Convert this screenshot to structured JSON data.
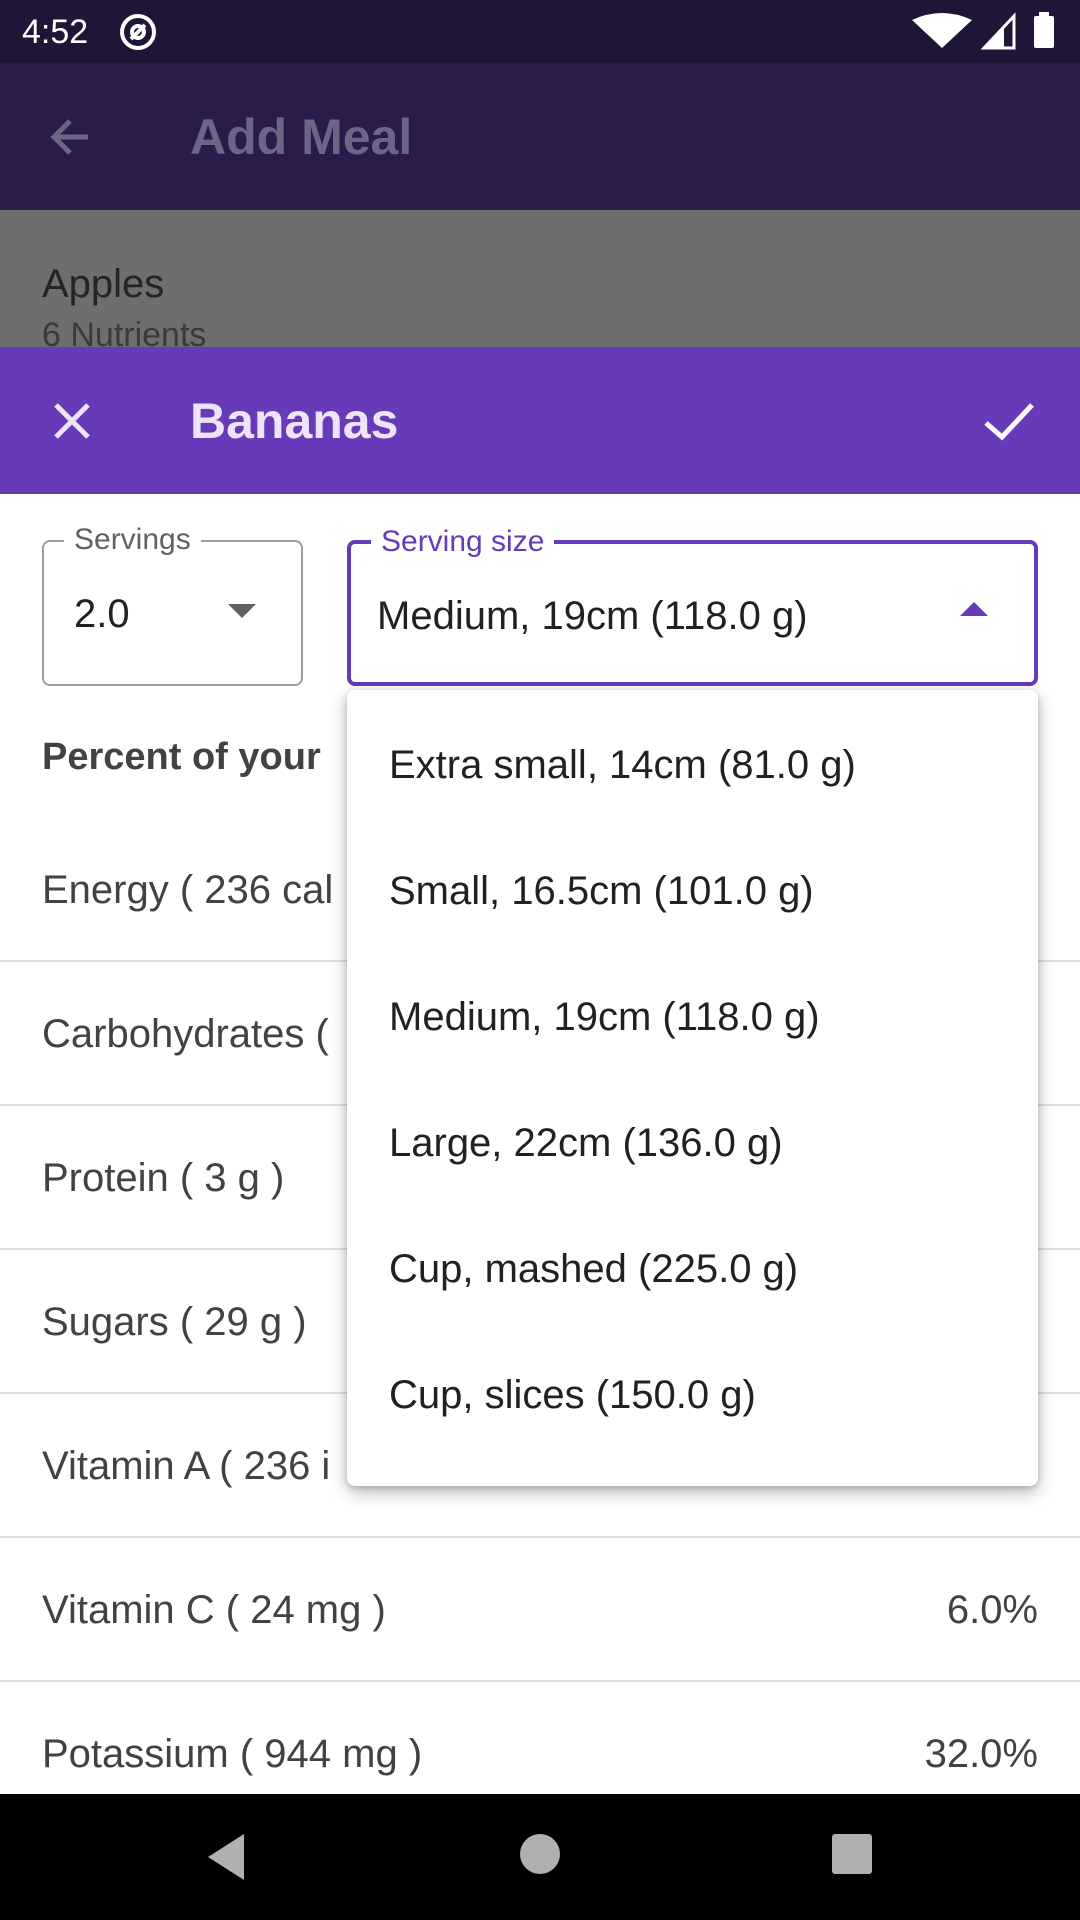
{
  "status_bar": {
    "time": "4:52",
    "left_icon": "at-sign-icon",
    "right_icons": [
      "wifi-icon",
      "signal-icon",
      "battery-icon"
    ]
  },
  "app_bar": {
    "title": "Add Meal",
    "back_icon": "arrow-back-icon"
  },
  "background_list": {
    "item_title": "Apples",
    "item_subtitle": "6 Nutrients"
  },
  "dialog": {
    "title": "Bananas",
    "close_icon": "close-icon",
    "confirm_icon": "check-icon",
    "accent_color": "#673ab7",
    "servings": {
      "label": "Servings",
      "value": "2.0"
    },
    "serving_size": {
      "label": "Serving size",
      "value": "Medium, 19cm (118.0 g)"
    },
    "section_heading": "Percent of your",
    "nutrients": [
      {
        "name": "Energy ( 236 cal",
        "percent": ""
      },
      {
        "name": "Carbohydrates (",
        "percent": ""
      },
      {
        "name": "Protein ( 3 g )",
        "percent": ""
      },
      {
        "name": "Sugars ( 29 g )",
        "percent": ""
      },
      {
        "name": "Vitamin A ( 236 i",
        "percent": ""
      },
      {
        "name": "Vitamin C ( 24 mg )",
        "percent": "6.0%"
      },
      {
        "name": "Potassium ( 944 mg )",
        "percent": "32.0%"
      }
    ]
  },
  "dropdown": {
    "options": [
      "Extra small, 14cm (81.0 g)",
      "Small, 16.5cm (101.0 g)",
      "Medium, 19cm (118.0 g)",
      "Large, 22cm (136.0 g)",
      "Cup, mashed (225.0 g)",
      "Cup, slices (150.0 g)"
    ]
  },
  "nav_bar": {
    "icons": [
      "nav-back-icon",
      "nav-home-icon",
      "nav-recents-icon"
    ]
  }
}
